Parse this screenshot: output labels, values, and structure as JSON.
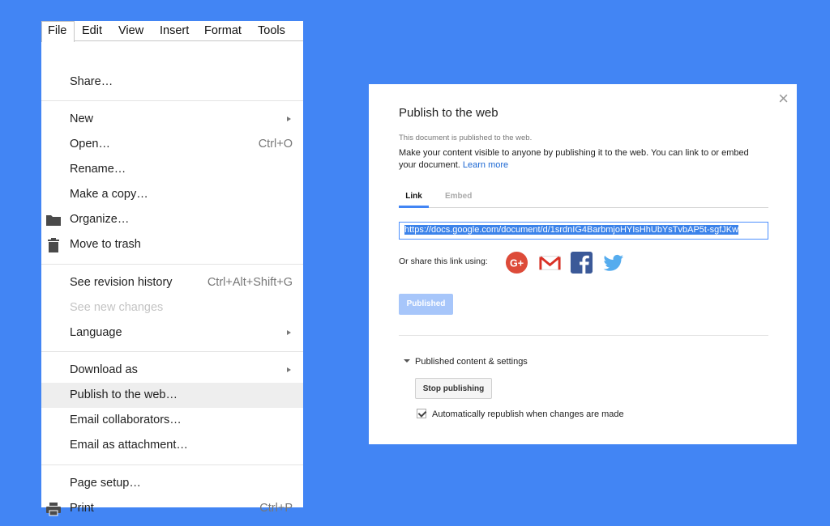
{
  "menubar": {
    "items": [
      "File",
      "Edit",
      "View",
      "Insert",
      "Format",
      "Tools"
    ]
  },
  "file_menu": {
    "share": "Share…",
    "new": "New",
    "open": "Open…",
    "open_shortcut": "Ctrl+O",
    "rename": "Rename…",
    "make_copy": "Make a copy…",
    "organize": "Organize…",
    "move_to_trash": "Move to trash",
    "revision_history": "See revision history",
    "revision_history_shortcut": "Ctrl+Alt+Shift+G",
    "see_new_changes": "See new changes",
    "language": "Language",
    "download_as": "Download as",
    "publish_to_web": "Publish to the web…",
    "email_collaborators": "Email collaborators…",
    "email_attachment": "Email as attachment…",
    "page_setup": "Page setup…",
    "print": "Print",
    "print_shortcut": "Ctrl+P",
    "icons": {
      "organize": "folder-icon",
      "move_to_trash": "trash-icon",
      "print": "printer-icon"
    }
  },
  "dialog": {
    "title": "Publish to the web",
    "note": "This document is published to the web.",
    "desc": "Make your content visible to anyone by publishing it to the web. You can link to or embed your document.",
    "learn_more": "Learn more",
    "tabs": [
      "Link",
      "Embed"
    ],
    "url": "https://docs.google.com/document/d/1srdnIG4BarbmjoHYIsHhUbYsTvbAP5t-sgfJKw",
    "share_label": "Or share this link using:",
    "social_icons": [
      "google-plus-icon",
      "gmail-icon",
      "facebook-icon",
      "twitter-icon"
    ],
    "published_label": "Published",
    "section_label": "Published content & settings",
    "stop_label": "Stop publishing",
    "auto_republish_label": "Automatically republish when changes are made",
    "auto_republish_checked": true
  },
  "colors": {
    "background": "#4285f4",
    "link": "#1a66d2",
    "published_button": "#a7c6fa",
    "google_plus": "#dd4b39",
    "facebook": "#3b5998",
    "twitter": "#55acee"
  }
}
